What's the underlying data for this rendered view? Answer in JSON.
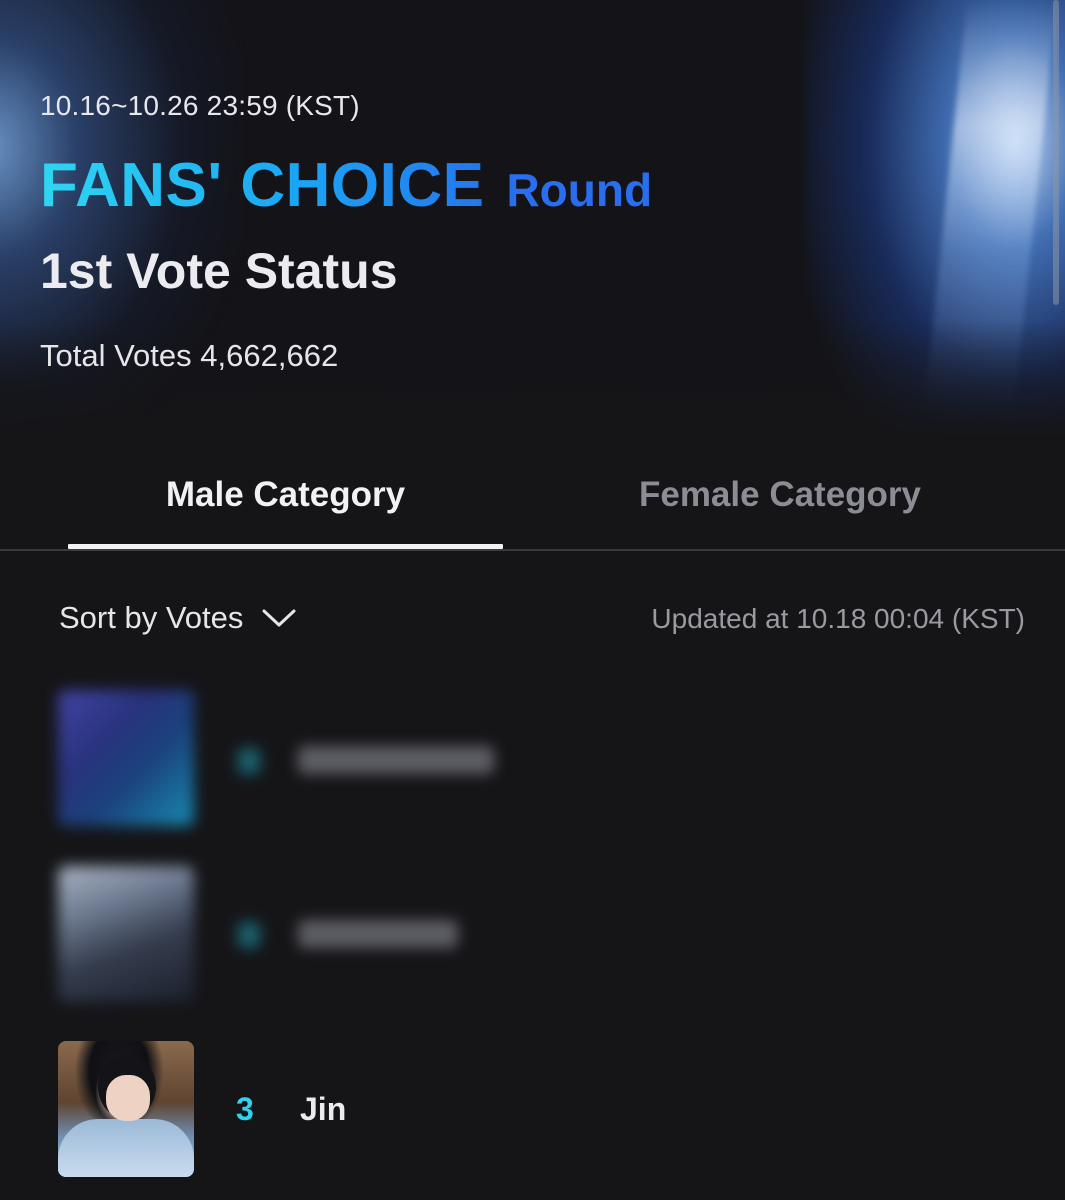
{
  "header": {
    "period": "10.16~10.26 23:59 (KST)",
    "title_main": "FANS' CHOICE",
    "title_round": "Round",
    "subtitle": "1st Vote Status",
    "total_votes_label": "Total Votes 4,662,662"
  },
  "tabs": [
    {
      "label": "Male Category",
      "active": true
    },
    {
      "label": "Female Category",
      "active": false
    }
  ],
  "sort": {
    "label": "Sort by Votes",
    "icon": "chevron-down-icon"
  },
  "updated_label": "Updated at 10.18 00:04 (KST)",
  "ranking": [
    {
      "rank": "",
      "name": "",
      "blurred": true
    },
    {
      "rank": "",
      "name": "",
      "blurred": true
    },
    {
      "rank": "3",
      "name": "Jin",
      "blurred": false
    }
  ],
  "colors": {
    "background": "#151518",
    "accent_cyan": "#2fd3ee",
    "accent_blue": "#2a6ef0",
    "tab_inactive": "#8c8c94"
  }
}
